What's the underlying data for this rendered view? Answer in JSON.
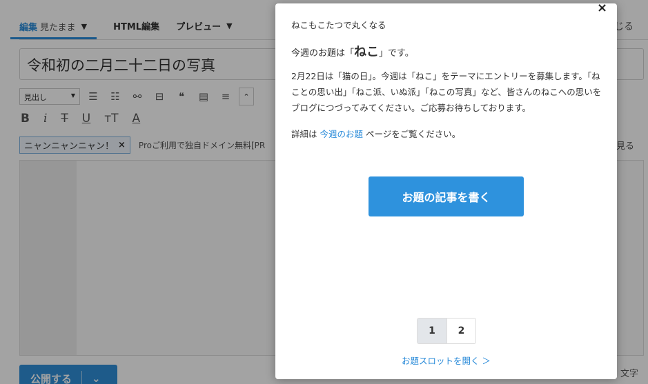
{
  "editor": {
    "tabs": [
      {
        "label": "編集",
        "sub": "見たまま"
      },
      {
        "label": "HTML編集"
      },
      {
        "label": "プレビュー"
      }
    ],
    "close_label": "じる",
    "title_value": "令和初の二月二十二日の写真",
    "heading_select": "見出し",
    "tag_label": "ニャンニャンニャン！",
    "ad_text": "Proご利用で独自ドメイン無料[PR",
    "see_label": "見る",
    "publish_label": "公開する",
    "char_label": "文字"
  },
  "modal": {
    "title": "ねこもこたつで丸くなる",
    "theme_prefix": "今週のお題は「",
    "theme_word": "ねこ",
    "theme_suffix": "」です。",
    "description": "2月22日は「猫の日」。今週は「ねこ」をテーマにエントリーを募集します。「ねことの思い出」「ねこ派、いぬ派」「ねこの写真」など、皆さんのねこへの思いをブログにつづってみてください。ご応募お待ちしております。",
    "detail_prefix": "詳細は ",
    "detail_link": "今週のお題",
    "detail_suffix": " ページをご覧ください。",
    "write_button": "お題の記事を書く",
    "pages": [
      "1",
      "2"
    ],
    "slot_link": "お題スロットを開く ＞",
    "close_glyph": "×"
  },
  "colors": {
    "accent": "#2e92dd",
    "overlay": "rgba(0,0,0,0.36)"
  }
}
